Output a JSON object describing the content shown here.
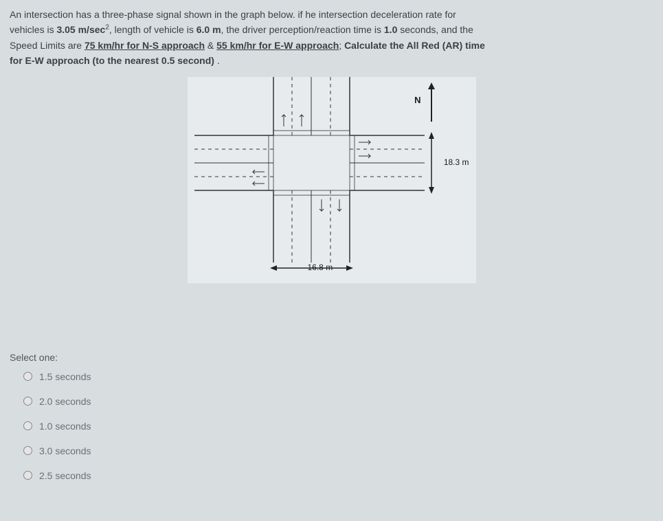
{
  "question": {
    "line1_part1": "An intersection has a three-phase signal shown in the graph below. if he intersection deceleration rate for",
    "line2_part1": "vehicles is ",
    "decel": "3.05 m/sec",
    "line2_part2": ", length of vehicle is ",
    "vehlen": "6.0 m",
    "line2_part3": ", the driver perception/reaction time is ",
    "prt": "1.0",
    "line2_part4": " seconds, and the",
    "line3_part1": "Speed Limits are ",
    "speed_ns": "75 km/hr for N-S approach",
    "amp": " & ",
    "speed_ew": "55 km/hr for E-W approach",
    "line3_part2": "; ",
    "calc": "Calculate the All Red (AR) time",
    "line4": "for E-W approach (to the nearest 0.5 second)"
  },
  "diagram": {
    "north_label": "N",
    "width_label": "16.8 m",
    "height_label": "18.3 m"
  },
  "select_label": "Select one:",
  "options": [
    {
      "label": "1.5 seconds"
    },
    {
      "label": "2.0 seconds"
    },
    {
      "label": "1.0 seconds"
    },
    {
      "label": "3.0 seconds"
    },
    {
      "label": "2.5 seconds"
    }
  ]
}
